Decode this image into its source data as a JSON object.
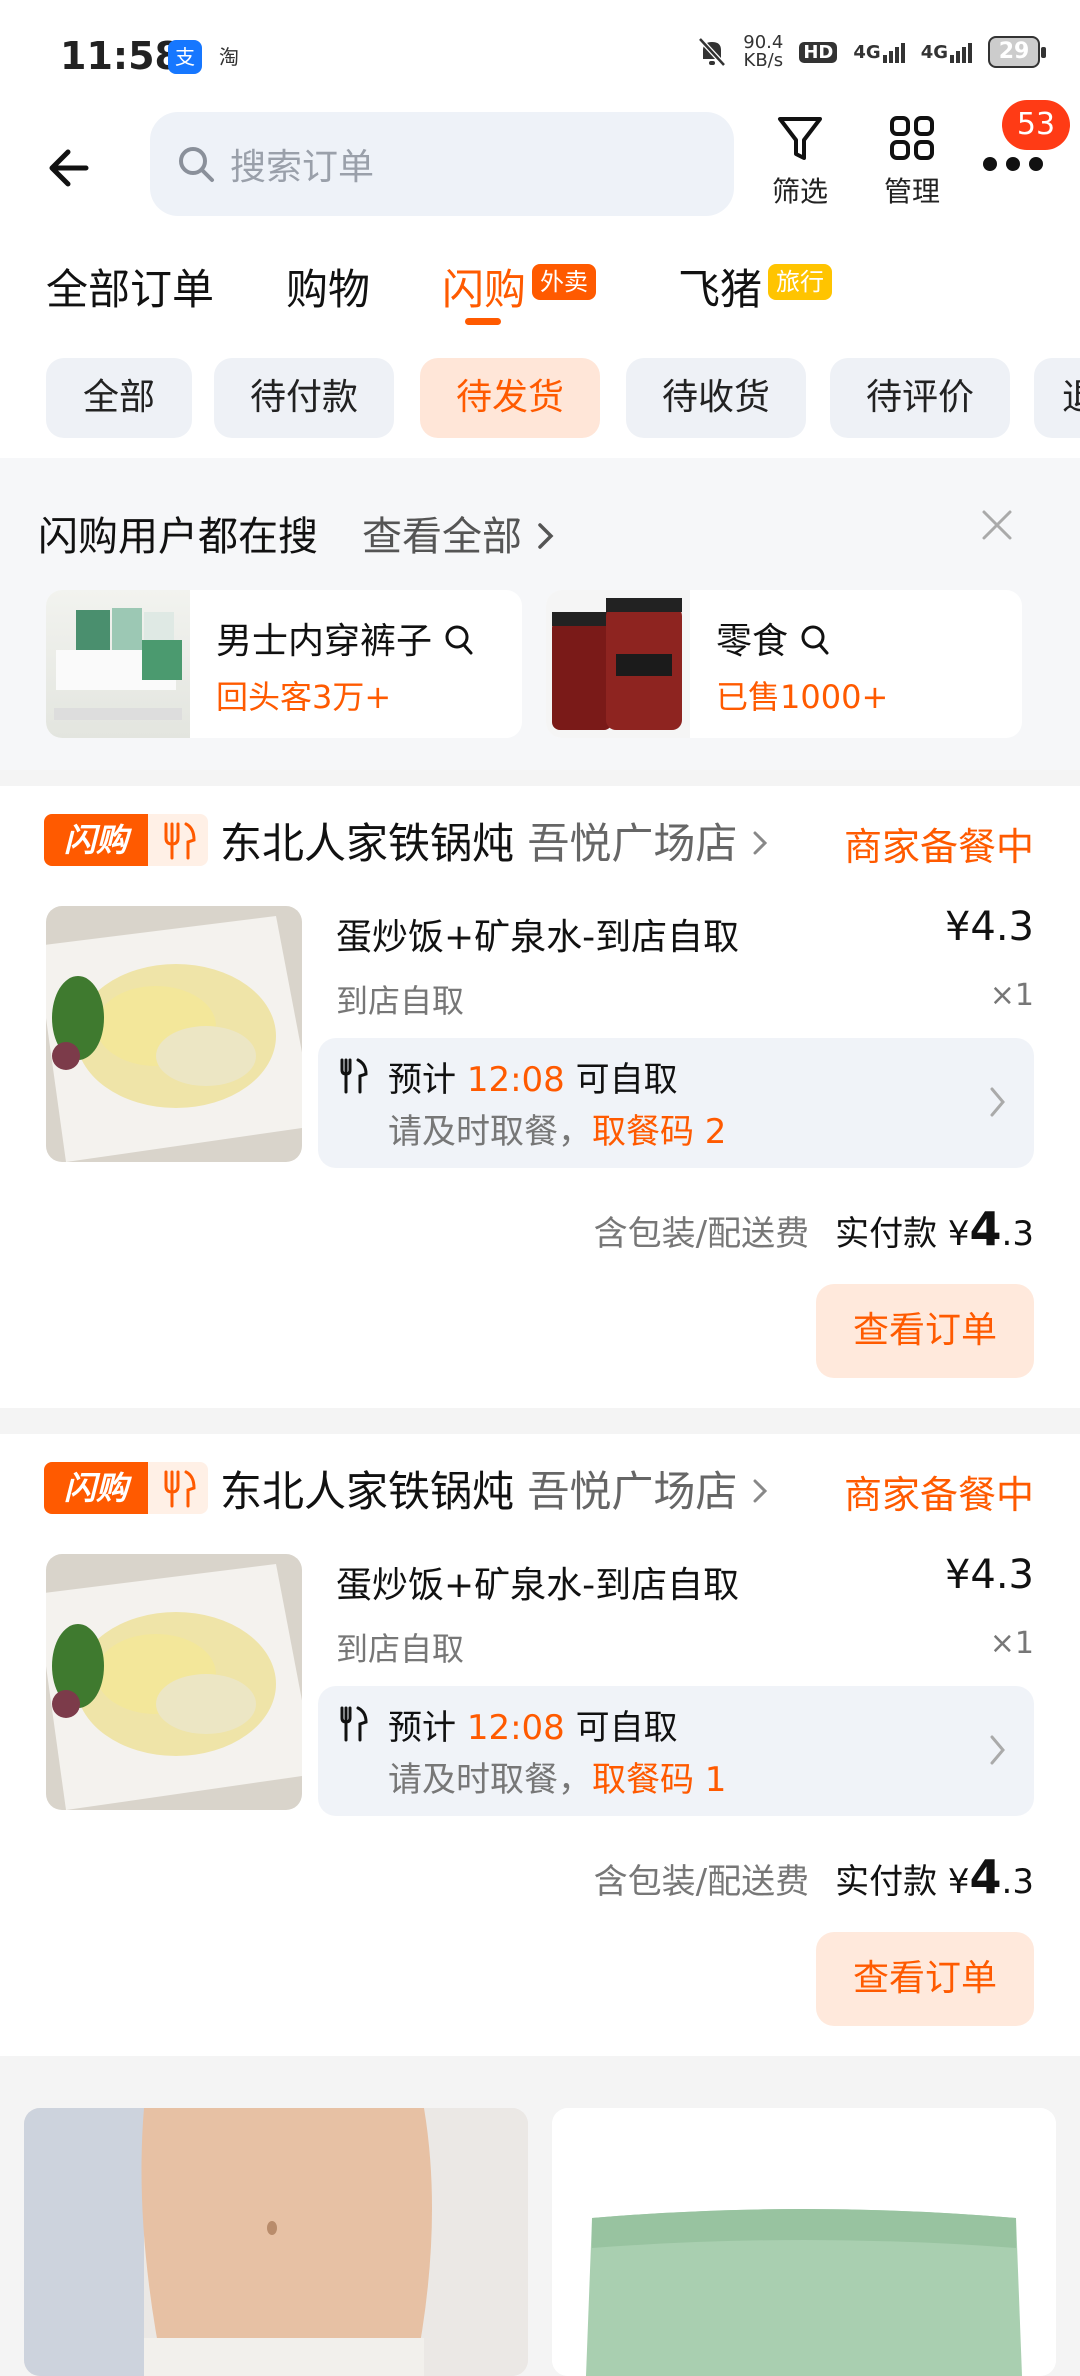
{
  "status": {
    "time": "11:58",
    "app1": "支",
    "app2": "淘",
    "net_speed": "90.4",
    "net_unit": "KB/s",
    "hd": "HD",
    "sig1": "4G",
    "sig2": "4G",
    "battery": "29"
  },
  "header": {
    "search_placeholder": "搜索订单",
    "filter_label": "筛选",
    "manage_label": "管理",
    "more_badge": "53"
  },
  "tabs": [
    {
      "label": "全部订单"
    },
    {
      "label": "购物"
    },
    {
      "label": "闪购",
      "tag": "外卖"
    },
    {
      "label": "飞猪",
      "tag": "旅行"
    }
  ],
  "chips": [
    "全部",
    "待付款",
    "待发货",
    "待收货",
    "待评价",
    "退"
  ],
  "hot": {
    "title": "闪购用户都在搜",
    "see_all": "查看全部",
    "cards": [
      {
        "title": "男士内穿裤子",
        "sub": "回头客3万+"
      },
      {
        "title": "零食",
        "sub": "已售1000+"
      }
    ]
  },
  "orders": [
    {
      "badge": "闪购",
      "shop": "东北人家铁锅炖",
      "branch": "吾悦广场店",
      "state": "商家备餐中",
      "item": "蛋炒饭+矿泉水-到店自取",
      "price": "¥4.3",
      "sub": "到店自取",
      "qty": "×1",
      "pick_pre": "预计",
      "pick_time": "12:08",
      "pick_post": "可自取",
      "remind": "请及时取餐，",
      "code": "取餐码 2",
      "fee": "含包装/配送费",
      "paid_label": "实付款",
      "currency": "¥",
      "paid_int": "4",
      "paid_dec": ".3",
      "view_btn": "查看订单"
    },
    {
      "badge": "闪购",
      "shop": "东北人家铁锅炖",
      "branch": "吾悦广场店",
      "state": "商家备餐中",
      "item": "蛋炒饭+矿泉水-到店自取",
      "price": "¥4.3",
      "sub": "到店自取",
      "qty": "×1",
      "pick_pre": "预计",
      "pick_time": "12:08",
      "pick_post": "可自取",
      "remind": "请及时取餐，",
      "code": "取餐码 1",
      "fee": "含包装/配送费",
      "paid_label": "实付款",
      "currency": "¥",
      "paid_int": "4",
      "paid_dec": ".3",
      "view_btn": "查看订单"
    }
  ],
  "colors": {
    "accent": "#ff5a00",
    "tag_travel": "#ffc400",
    "badge": "#ff3b15"
  }
}
